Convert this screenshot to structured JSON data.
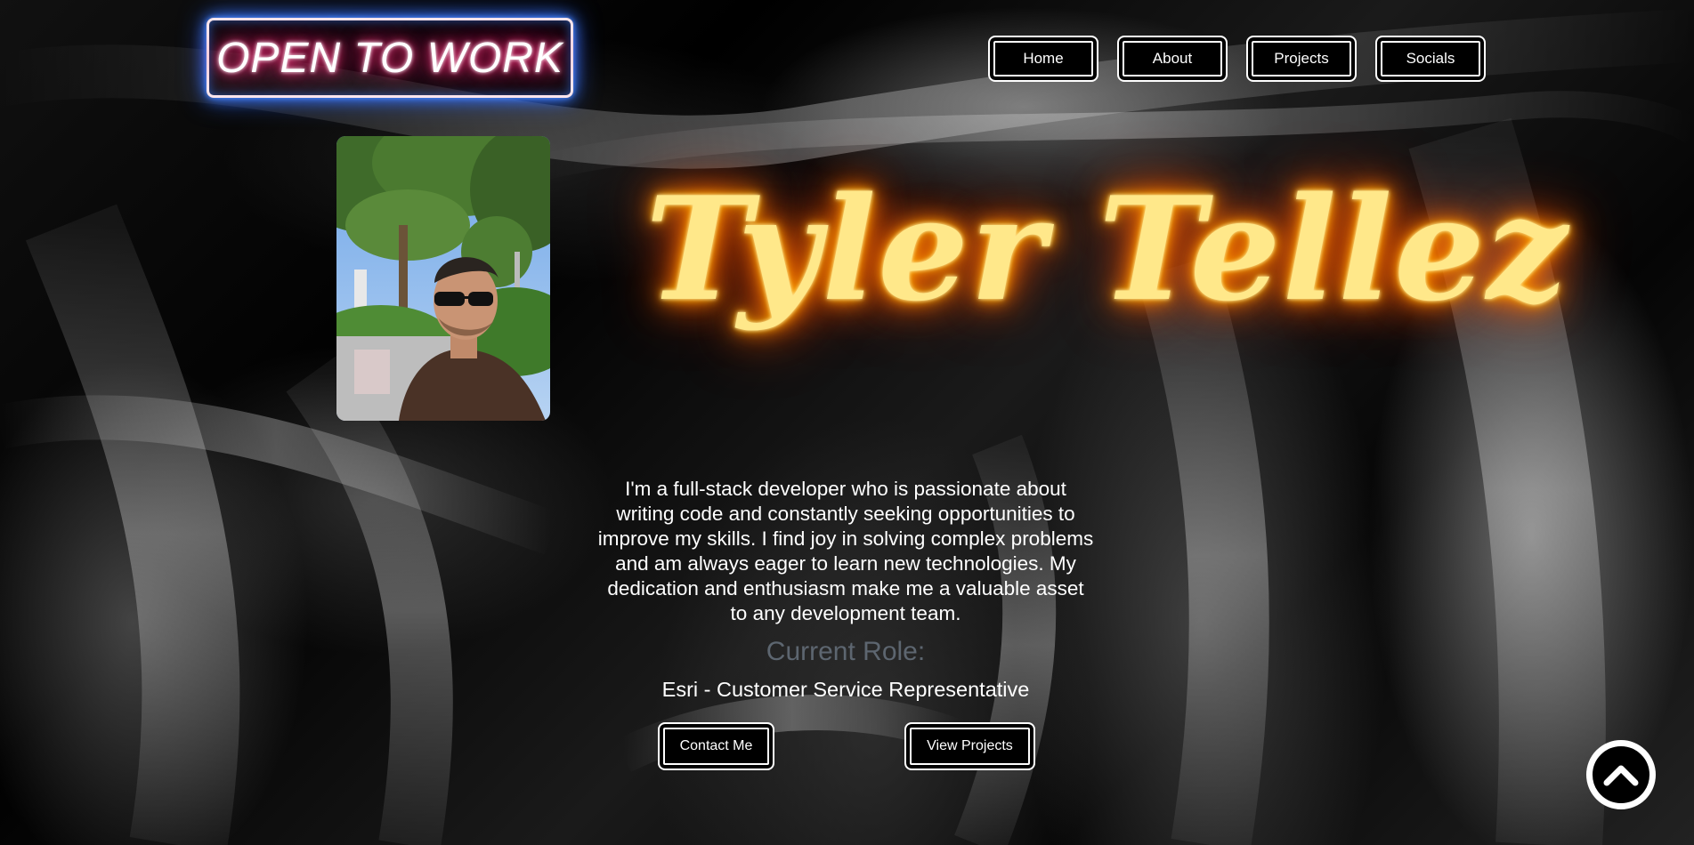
{
  "badge": {
    "text": "OPEN TO WORK"
  },
  "nav": {
    "items": [
      {
        "label": "Home"
      },
      {
        "label": "About"
      },
      {
        "label": "Projects"
      },
      {
        "label": "Socials"
      }
    ]
  },
  "hero": {
    "name": "Tyler Tellez",
    "photo_icon": "profile-photo",
    "bio": "I'm a full-stack developer who is passionate about writing code and constantly seeking opportunities to improve my skills. I find joy in solving complex problems and am always eager to learn new technologies. My dedication and enthusiasm make me a valuable asset to any development team.",
    "role_title": "Current Role:",
    "role_value": "Esri - Customer Service Representative",
    "contact_label": "Contact Me",
    "projects_label": "View Projects"
  },
  "scroll_top": {
    "icon": "chevron-up-icon"
  },
  "colors": {
    "neon_name": "#ffe88a",
    "neon_name_glow": "#ff8a00",
    "badge_glow": "#3c7dff",
    "badge_text_glow": "#ff1f6a",
    "role_title": "#5d6670"
  }
}
